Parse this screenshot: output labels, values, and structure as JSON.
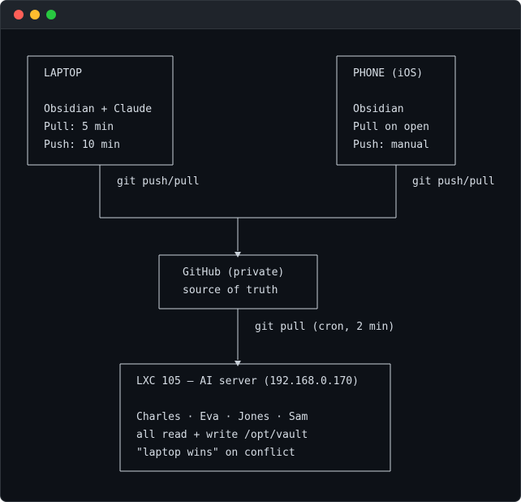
{
  "window": {
    "controls": {
      "close_color": "#ff5f57",
      "minimize_color": "#febc2e",
      "maximize_color": "#28c840"
    }
  },
  "nodes": {
    "laptop": {
      "title": "LAPTOP",
      "lines": [
        "Obsidian + Claude",
        "Pull: 5 min",
        "Push: 10 min"
      ]
    },
    "phone": {
      "title": "PHONE (iOS)",
      "lines": [
        "Obsidian",
        "Pull on open",
        "Push: manual"
      ]
    },
    "github": {
      "lines": [
        "GitHub (private)",
        "source of truth"
      ]
    },
    "server": {
      "title": "LXC 105 — AI server (192.168.0.170)",
      "lines": [
        "Charles · Eva · Jones · Sam",
        "all read + write /opt/vault",
        "\"laptop wins\" on conflict"
      ]
    }
  },
  "edges": {
    "laptop_to_github": "git push/pull",
    "phone_to_github": "git push/pull",
    "github_to_server": "git pull (cron, 2 min)"
  }
}
